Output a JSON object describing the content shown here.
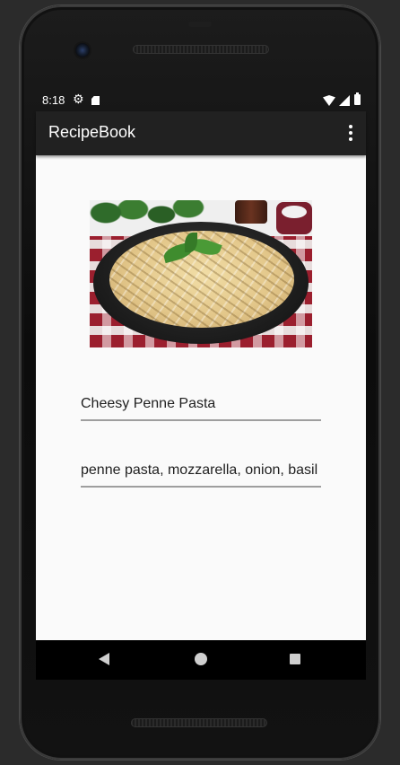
{
  "status_bar": {
    "time": "8:18",
    "icons": [
      "gear-icon",
      "sd-card-icon",
      "wifi-icon",
      "signal-icon",
      "battery-icon"
    ]
  },
  "app_bar": {
    "title": "RecipeBook",
    "menu_icon": "more-vert-icon"
  },
  "recipe": {
    "image_description": "pasta-photo",
    "name_value": "Cheesy Penne Pasta",
    "ingredients_value": "penne pasta, mozzarella, onion, basil"
  },
  "nav_bar": {
    "buttons": [
      "back-icon",
      "home-icon",
      "recents-icon"
    ]
  },
  "colors": {
    "app_bar": "#212121",
    "content_bg": "#fafafa",
    "field_underline": "#9e9e9e",
    "text": "#1f1f1f"
  }
}
